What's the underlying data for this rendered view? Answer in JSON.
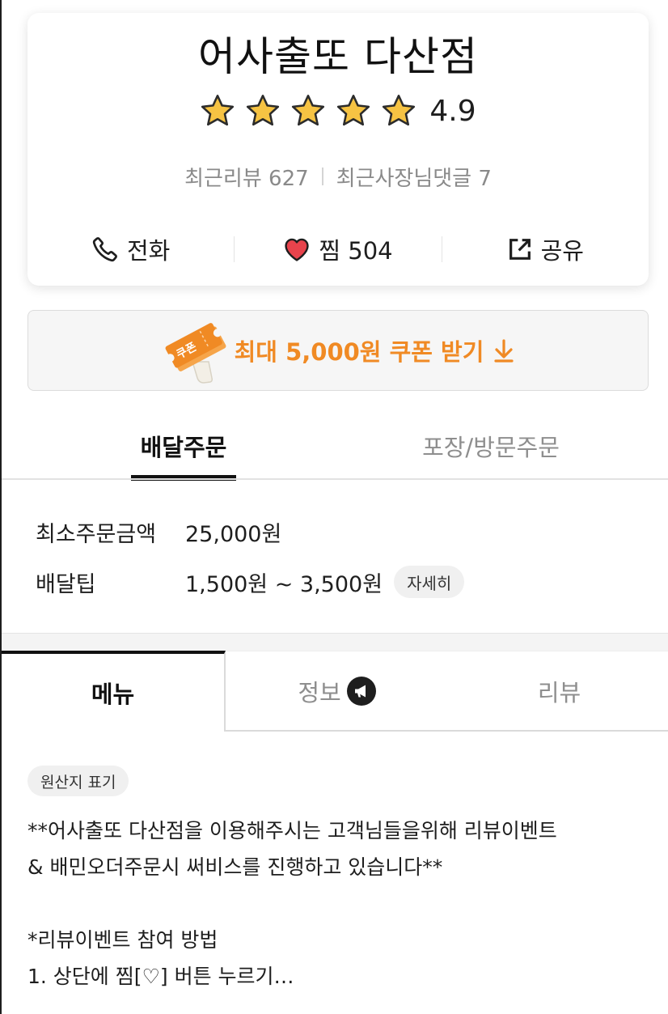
{
  "store": {
    "name": "어사출또 다산점",
    "rating": "4.9",
    "rating_stars": 5,
    "stats": [
      {
        "label": "최근리뷰 627"
      },
      {
        "label": "최근사장님댓글 7"
      }
    ]
  },
  "actions": {
    "call": "전화",
    "favorite": "찜 504",
    "share": "공유"
  },
  "coupon": {
    "label": "최대 5,000원 쿠폰 받기",
    "icon_text": "쿠폰"
  },
  "order_tabs": [
    {
      "label": "배달주문",
      "active": true
    },
    {
      "label": "포장/방문주문",
      "active": false
    }
  ],
  "delivery": {
    "min_order_label": "최소주문금액",
    "min_order_value": "25,000원",
    "tip_label": "배달팁",
    "tip_value": "1,500원 ~ 3,500원",
    "detail_button": "자세히"
  },
  "main_tabs": [
    {
      "label": "메뉴",
      "active": true
    },
    {
      "label": "정보",
      "active": false
    },
    {
      "label": "리뷰",
      "active": false
    }
  ],
  "notice": {
    "origin_chip": "원산지 표기",
    "lines": [
      "**어사출또 다산점을 이용해주시는 고객님들을위해 리뷰이벤트",
      "& 배민오더주문시 써비스를 진행하고 있습니다**",
      "",
      "*리뷰이벤트 참여 방법",
      "1. 상단에 찜[♡] 버튼 누르기…"
    ]
  },
  "colors": {
    "accent": "#f08a24",
    "star": "#f6c343",
    "heart": "#e8434c"
  }
}
